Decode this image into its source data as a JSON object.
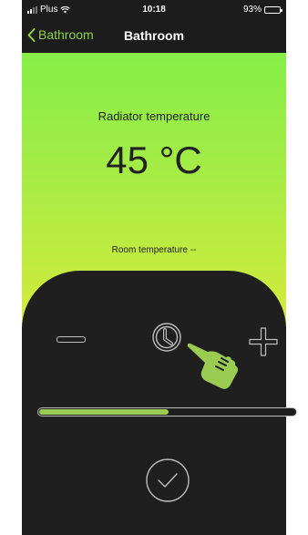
{
  "status_bar": {
    "carrier": "Plus",
    "time": "10:18",
    "battery": "93%",
    "battery_level": 0.93,
    "icons": [
      "signal-icon",
      "wifi-icon",
      "battery-icon"
    ]
  },
  "nav": {
    "back_label": "Bathroom",
    "title": "Bathroom"
  },
  "main": {
    "radiator_label": "Radiator temperature",
    "temperature": "45 °C",
    "room_temperature": "Room temperature --"
  },
  "controls": {
    "icons": [
      "minus-icon",
      "clock-icon",
      "plus-icon",
      "pointing-hand-icon",
      "checkmark-icon"
    ],
    "progress": 0.5
  },
  "colors": {
    "accent": "#8fd14a",
    "gradient_top": "#86ee47",
    "gradient_bottom": "#d6ea3c",
    "panel": "#1f1f1f",
    "progress_fill": "#9bcc52"
  }
}
